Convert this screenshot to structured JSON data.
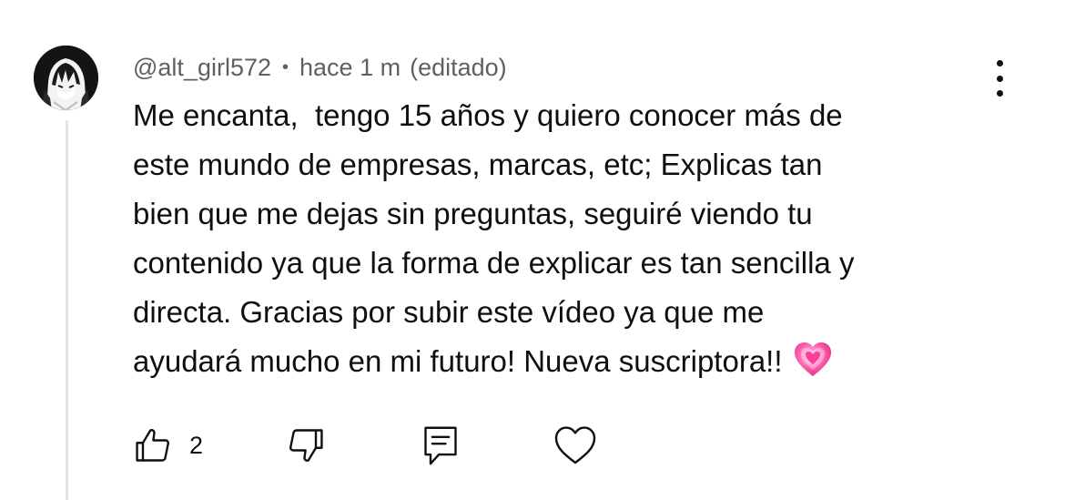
{
  "comment": {
    "author": "@alt_girl572",
    "separator": "•",
    "time": "hace 1 m",
    "edited": "(editado)",
    "text_lines": [
      "Me encanta,  tengo 15 años y quiero conocer más de",
      "este mundo de empresas, marcas, etc; Explicas tan",
      "bien que me dejas sin preguntas, seguiré viendo tu",
      "contenido ya que la forma de explicar es tan sencilla y",
      "directa. Gracias por subir este vídeo ya que me",
      "ayudará mucho en mi futuro! Nueva suscriptora!!"
    ],
    "emoji": "growing-heart-emoji",
    "likes": "2"
  },
  "icons": {
    "avatar": "anime-girl-avatar",
    "more": "vertical-dots-icon",
    "like": "thumbs-up-icon",
    "dislike": "thumbs-down-icon",
    "reply": "reply-comment-icon",
    "heart": "heart-icon"
  },
  "colors": {
    "text": "#0f0f0f",
    "meta": "#606060",
    "thread_line": "#e5e5e5",
    "emoji_pink": "#ff4fa3"
  }
}
